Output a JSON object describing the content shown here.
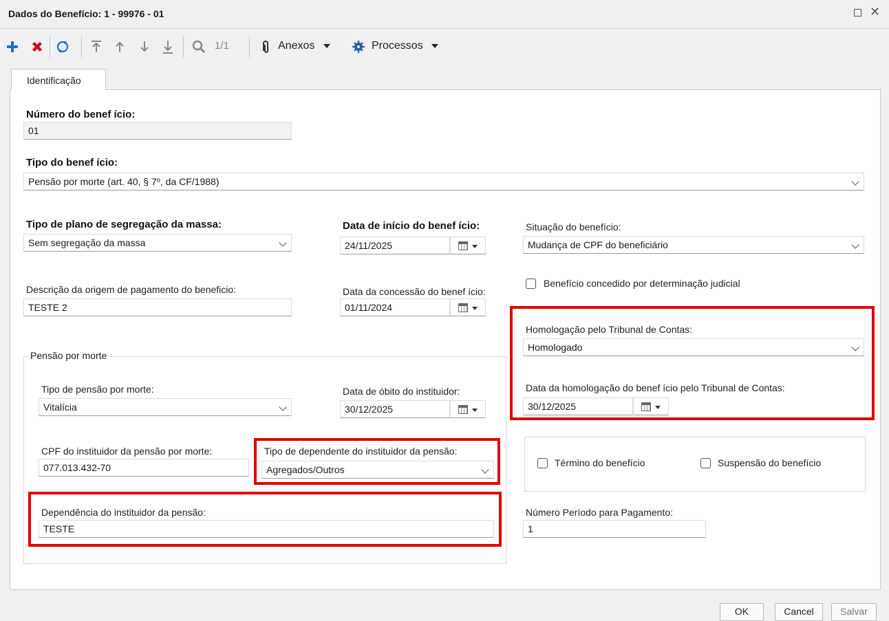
{
  "window": {
    "title": "Dados do Benefício: 1 - 99976 - 01"
  },
  "toolbar": {
    "add_icon": "plus-icon",
    "delete_icon": "x-icon",
    "refresh_icon": "refresh-icon",
    "first_icon": "arrow-first-icon",
    "up_icon": "arrow-up-icon",
    "down_icon": "arrow-down-icon",
    "last_icon": "arrow-last-icon",
    "search_icon": "search-icon",
    "page_counter": "1/1",
    "attachments_label": "Anexos",
    "processes_label": "Processos"
  },
  "tabs": [
    {
      "label": "Identificação"
    }
  ],
  "form": {
    "numero_beneficio": {
      "label": "Número do benef ício:",
      "value": "01"
    },
    "tipo_beneficio": {
      "label": "Tipo do benef ício:",
      "value": "Pensão por morte (art. 40, § 7º, da CF/1988)"
    },
    "tipo_plano": {
      "label": "Tipo de plano de segregação da massa:",
      "value": "Sem segregação da massa"
    },
    "data_inicio": {
      "label": "Data de início do benef ício:",
      "value": "24/11/2025"
    },
    "situacao": {
      "label": "Situação do benefício:",
      "value": "Mudança de CPF do beneficiário"
    },
    "descricao_origem": {
      "label": "Descrição da origem de pagamento do beneficio:",
      "value": "TESTE 2"
    },
    "data_concessao": {
      "label": "Data da concessão do benef ício:",
      "value": "01/11/2024"
    },
    "judicial": {
      "label": "Benefício concedido por determinação judicial"
    },
    "homologacao": {
      "label": "Homologação pelo Tribunal de Contas:",
      "value": "Homologado"
    },
    "data_homologacao": {
      "label": "Data da homologação do benef ício pelo Tribunal de Contas:",
      "value": "30/12/2025"
    },
    "pensao_group": {
      "title": "Pensão por morte",
      "tipo_pensao": {
        "label": "Tipo de pensão por morte:",
        "value": "Vitalícia"
      },
      "data_obito": {
        "label": "Data de óbito do instituidor:",
        "value": "30/12/2025"
      },
      "cpf_instituidor": {
        "label": "CPF do instituidor da pensão por morte:",
        "value": "077.013.432-70"
      },
      "tipo_dependente": {
        "label": "Tipo de dependente do instituidor da pensão:",
        "value": "Agregados/Outros"
      },
      "dependencia": {
        "label": "Dependência do instituidor da pensão:",
        "value": "TESTE"
      }
    },
    "termino": {
      "label": "Término do benefício"
    },
    "suspensao": {
      "label": "Suspensão do benefício"
    },
    "numero_periodo": {
      "label": "Número Período para Pagamento:",
      "value": "1"
    }
  },
  "footer": {
    "ok_label": "OK",
    "cancel_label": "Cancel",
    "save_label": "Salvar"
  },
  "colors": {
    "highlight": "#e00000",
    "add": "#1a73c8",
    "delete": "#d0021b"
  }
}
